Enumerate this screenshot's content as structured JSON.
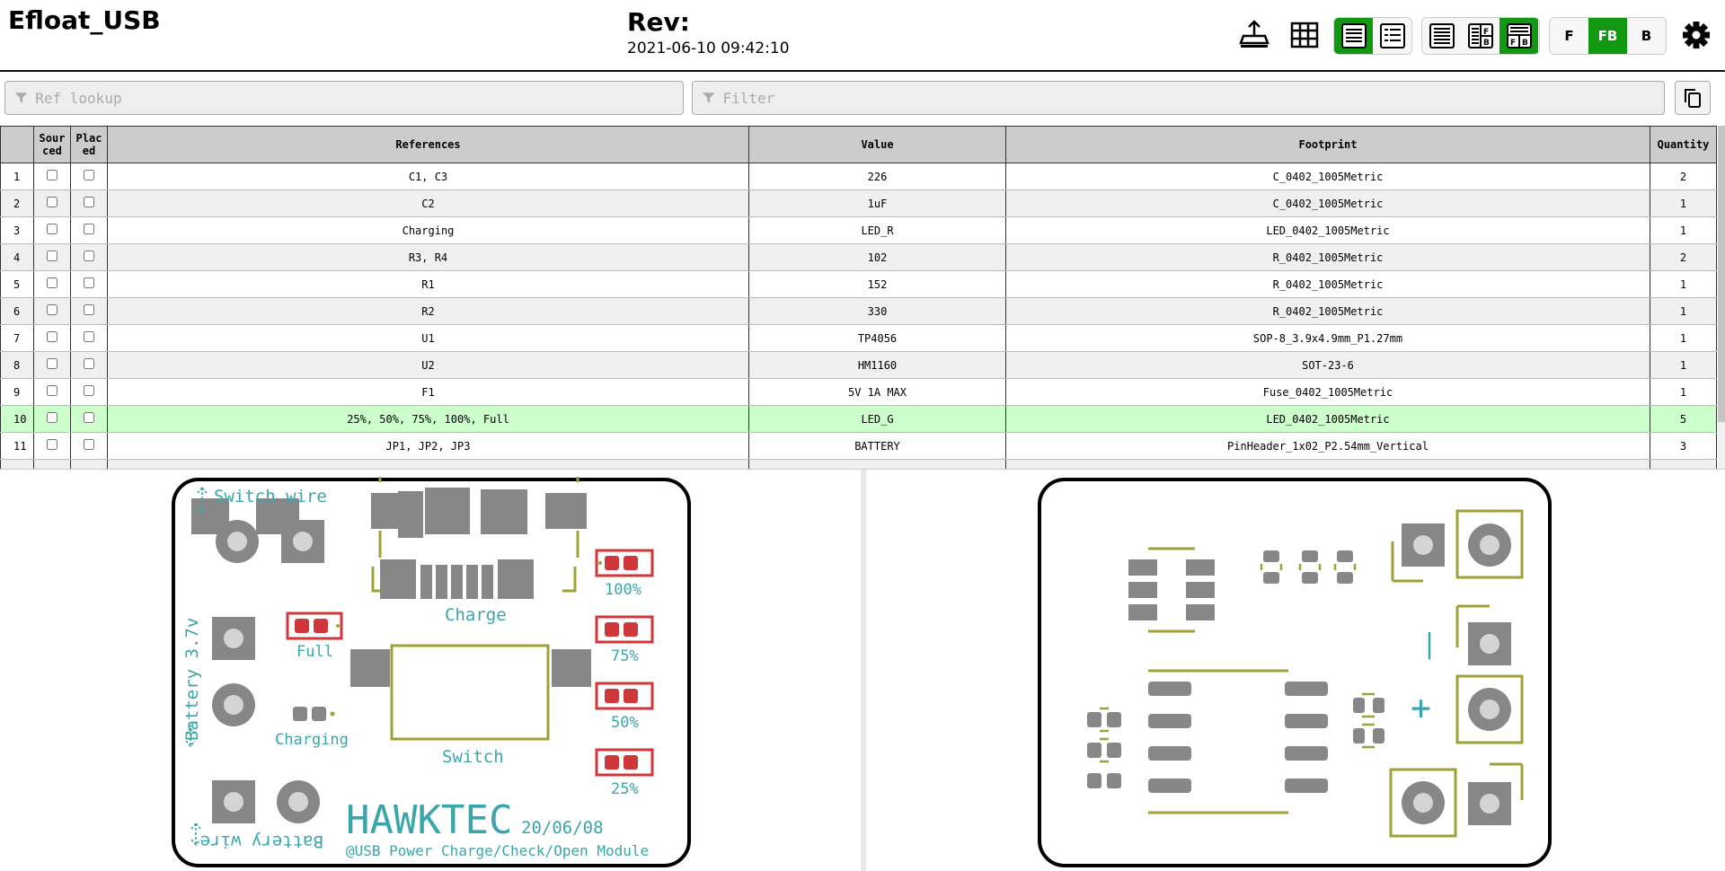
{
  "header": {
    "title": "Efloat_USB",
    "rev_label": "Rev:",
    "date": "2021-06-10 09:42:10"
  },
  "toolbar": {
    "layer_buttons": {
      "front": "F",
      "both": "FB",
      "back": "B"
    },
    "active_layer": "FB",
    "accent_color": "#119911"
  },
  "filters": {
    "ref_lookup_placeholder": "Ref lookup",
    "filter_placeholder": "Filter"
  },
  "bom": {
    "columns": [
      "",
      "Sour ced",
      "Plac ed",
      "References",
      "Value",
      "Footprint",
      "Quantity"
    ],
    "rows": [
      {
        "n": "1",
        "refs": "C1, C3",
        "value": "226",
        "footprint": "C_0402_1005Metric",
        "qty": "2"
      },
      {
        "n": "2",
        "refs": "C2",
        "value": "1uF",
        "footprint": "C_0402_1005Metric",
        "qty": "1"
      },
      {
        "n": "3",
        "refs": "Charging",
        "value": "LED_R",
        "footprint": "LED_0402_1005Metric",
        "qty": "1"
      },
      {
        "n": "4",
        "refs": "R3, R4",
        "value": "102",
        "footprint": "R_0402_1005Metric",
        "qty": "2"
      },
      {
        "n": "5",
        "refs": "R1",
        "value": "152",
        "footprint": "R_0402_1005Metric",
        "qty": "1"
      },
      {
        "n": "6",
        "refs": "R2",
        "value": "330",
        "footprint": "R_0402_1005Metric",
        "qty": "1"
      },
      {
        "n": "7",
        "refs": "U1",
        "value": "TP4056",
        "footprint": "SOP-8_3.9x4.9mm_P1.27mm",
        "qty": "1"
      },
      {
        "n": "8",
        "refs": "U2",
        "value": "HM1160",
        "footprint": "SOT-23-6",
        "qty": "1"
      },
      {
        "n": "9",
        "refs": "F1",
        "value": "5V 1A MAX",
        "footprint": "Fuse_0402_1005Metric",
        "qty": "1"
      },
      {
        "n": "10",
        "refs": "25%, 50%, 75%, 100%, Full",
        "value": "LED_G",
        "footprint": "LED_0402_1005Metric",
        "qty": "5",
        "highlight": true
      },
      {
        "n": "11",
        "refs": "JP1, JP2, JP3",
        "value": "BATTERY",
        "footprint": "PinHeader_1x02_P2.54mm_Vertical",
        "qty": "3"
      }
    ],
    "highlight_color": "#ccffcc"
  },
  "front_board": {
    "label_switch_wire": "Switch wire",
    "label_battery": "Battery 3.7v",
    "label_battery_wire": "Battery wire",
    "label_charge": "Charge",
    "label_switch": "Switch",
    "label_full": "Full",
    "label_charging": "Charging",
    "label_100": "100%",
    "label_75": "75%",
    "label_50": "50%",
    "label_25": "25%",
    "brand": "HAWKTEC",
    "board_date": "20/06/08",
    "description": "@USB Power Charge/Check/Open Module",
    "silk_color": "#3aa6a9",
    "pad_color": "#878787",
    "highlight_pad_color": "#d0373a",
    "outline_color": "#a0a038"
  },
  "back_board": {
    "minus_sign": "|",
    "plus_sign": "+"
  }
}
